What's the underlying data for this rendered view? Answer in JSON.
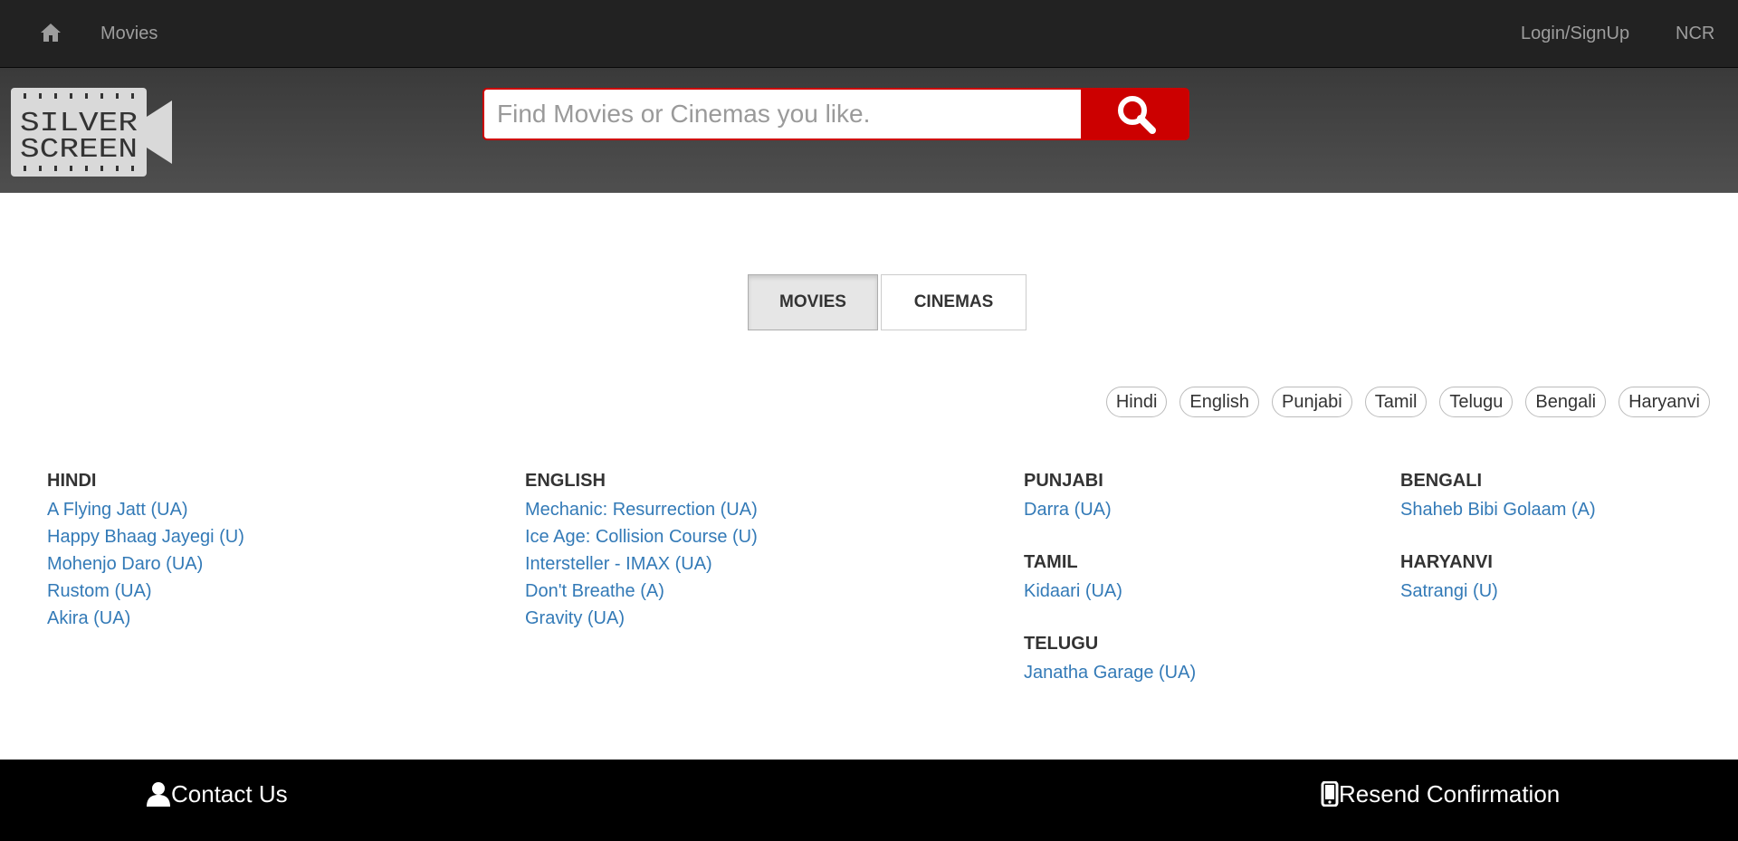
{
  "navbar": {
    "home_icon": "home-icon",
    "movies_label": "Movies",
    "login_label": "Login/SignUp",
    "city_label": "NCR"
  },
  "logo": {
    "line1": "SILVER",
    "line2": "SCREEN"
  },
  "search": {
    "placeholder": "Find Movies or Cinemas you like.",
    "value": "",
    "button_icon": "search-icon",
    "accent": "#cc0000"
  },
  "toggle": {
    "movies_label": "MOVIES",
    "cinemas_label": "CINEMAS",
    "active": "MOVIES"
  },
  "languages": [
    "Hindi",
    "English",
    "Punjabi",
    "Tamil",
    "Telugu",
    "Bengali",
    "Haryanvi"
  ],
  "groups": {
    "hindi": {
      "title": "HINDI",
      "movies": [
        "A Flying Jatt (UA)",
        "Happy Bhaag Jayegi (U)",
        "Mohenjo Daro (UA)",
        "Rustom (UA)",
        "Akira (UA)"
      ]
    },
    "english": {
      "title": "ENGLISH",
      "movies": [
        "Mechanic: Resurrection (UA)",
        "Ice Age: Collision Course (U)",
        "Intersteller - IMAX (UA)",
        "Don't Breathe (A)",
        "Gravity (UA)"
      ]
    },
    "punjabi": {
      "title": "PUNJABI",
      "movies": [
        "Darra (UA)"
      ]
    },
    "tamil": {
      "title": "TAMIL",
      "movies": [
        "Kidaari (UA)"
      ]
    },
    "telugu": {
      "title": "TELUGU",
      "movies": [
        "Janatha Garage (UA)"
      ]
    },
    "bengali": {
      "title": "BENGALI",
      "movies": [
        "Shaheb Bibi Golaam (A)"
      ]
    },
    "haryanvi": {
      "title": "HARYANVI",
      "movies": [
        "Satrangi (U)"
      ]
    }
  },
  "footer": {
    "contact_label": "Contact Us",
    "contact_icon": "user-icon",
    "resend_label": "Resend Confirmation",
    "resend_icon": "mobile-phone-icon"
  },
  "colors": {
    "navbar_bg": "#222222",
    "header_bg": "#4a4a4a",
    "link": "#337ab7",
    "footer_bg": "#000000"
  }
}
